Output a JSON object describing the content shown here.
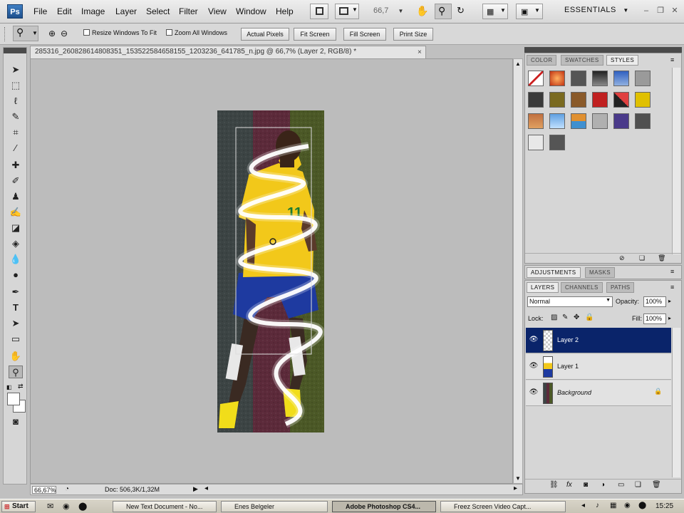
{
  "app": {
    "logo": "Ps",
    "menu": [
      "File",
      "Edit",
      "Image",
      "Layer",
      "Select",
      "Filter",
      "View",
      "Window",
      "Help"
    ],
    "zoom_display": "66,7",
    "workspace": "ESSENTIALS"
  },
  "options_bar": {
    "resize_windows_label": "Resize Windows To Fit",
    "zoom_all_windows_label": "Zoom All Windows",
    "actual_pixels": "Actual Pixels",
    "fit_screen": "Fit Screen",
    "fill_screen": "Fill Screen",
    "print_size": "Print Size"
  },
  "document": {
    "tab_title": "285316_260828614808351_153522584658155_1203236_641785_n.jpg @ 66,7% (Layer 2, RGB/8) *",
    "close": "×",
    "status_zoom": "66,67%",
    "status_doc": "Doc: 506,3K/1,32M",
    "jersey_number": "11"
  },
  "styles_panel": {
    "tabs": [
      "COLOR",
      "SWATCHES",
      "STYLES"
    ],
    "active_tab": "STYLES"
  },
  "adjust_panel": {
    "tabs": [
      "ADJUSTMENTS",
      "MASKS"
    ]
  },
  "layers_panel": {
    "tabs": [
      "LAYERS",
      "CHANNELS",
      "PATHS"
    ],
    "blend_mode": "Normal",
    "opacity_label": "Opacity:",
    "opacity_value": "100%",
    "lock_label": "Lock:",
    "fill_label": "Fill:",
    "fill_value": "100%",
    "layers": [
      {
        "name": "Layer 2",
        "selected": true
      },
      {
        "name": "Layer 1",
        "selected": false
      },
      {
        "name": "Background",
        "selected": false
      }
    ]
  },
  "taskbar": {
    "start": "Start",
    "tasks": [
      "New Text Document - No...",
      "Enes Belgeler",
      "Adobe Photoshop CS4...",
      "Freez Screen Video Capt..."
    ],
    "clock": "15:25"
  },
  "colors": {
    "selected_layer": "#0a246a",
    "canvas_bg": "#bcbcbc",
    "jersey_yellow": "#f2c81a",
    "shorts_blue": "#1e3aa0"
  }
}
